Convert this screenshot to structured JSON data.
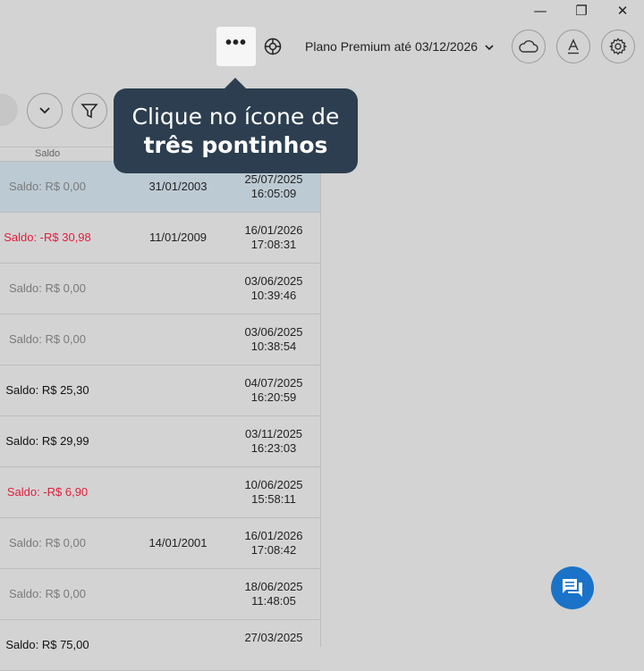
{
  "window": {
    "minimize_glyph": "—",
    "restore_glyph": "❐",
    "close_glyph": "✕"
  },
  "toolbar": {
    "more_glyph": "•••",
    "plan_text": "Plano Premium até 03/12/2026",
    "icons": [
      "globe-icon",
      "cloud-icon",
      "font-icon",
      "gear-icon"
    ]
  },
  "tooltip": {
    "line1": "Clique no ícone de",
    "line2": "três pontinhos",
    "bg_color": "#2c3e50"
  },
  "table": {
    "header_saldo": "Saldo",
    "rows": [
      {
        "saldo": "Saldo: R$ 0,00",
        "saldo_type": "zero",
        "birth": "31/01/2003",
        "date": "25/07/2025",
        "time": "16:05:09",
        "selected": true
      },
      {
        "saldo": "Saldo: -R$ 30,98",
        "saldo_type": "neg",
        "birth": "11/01/2009",
        "date": "16/01/2026",
        "time": "17:08:31"
      },
      {
        "saldo": "Saldo: R$ 0,00",
        "saldo_type": "zero",
        "birth": "",
        "date": "03/06/2025",
        "time": "10:39:46"
      },
      {
        "saldo": "Saldo: R$ 0,00",
        "saldo_type": "zero",
        "birth": "",
        "date": "03/06/2025",
        "time": "10:38:54"
      },
      {
        "saldo": "Saldo: R$ 25,30",
        "saldo_type": "pos",
        "birth": "",
        "date": "04/07/2025",
        "time": "16:20:59"
      },
      {
        "saldo": "Saldo: R$ 29,99",
        "saldo_type": "pos",
        "birth": "",
        "date": "03/11/2025",
        "time": "16:23:03"
      },
      {
        "saldo": "Saldo: -R$ 6,90",
        "saldo_type": "neg",
        "birth": "",
        "date": "10/06/2025",
        "time": "15:58:11"
      },
      {
        "saldo": "Saldo: R$ 0,00",
        "saldo_type": "zero",
        "birth": "14/01/2001",
        "date": "16/01/2026",
        "time": "17:08:42"
      },
      {
        "saldo": "Saldo: R$ 0,00",
        "saldo_type": "zero",
        "birth": "",
        "date": "18/06/2025",
        "time": "11:48:05"
      },
      {
        "saldo": "Saldo: R$ 75,00",
        "saldo_type": "pos",
        "birth": "",
        "date": "27/03/2025",
        "time": ""
      }
    ]
  },
  "colors": {
    "overlay_bg": "#d3d3d3",
    "selected_row": "#bccad4",
    "negative": "#e01e3c",
    "chat_fab": "#1a73c8"
  }
}
